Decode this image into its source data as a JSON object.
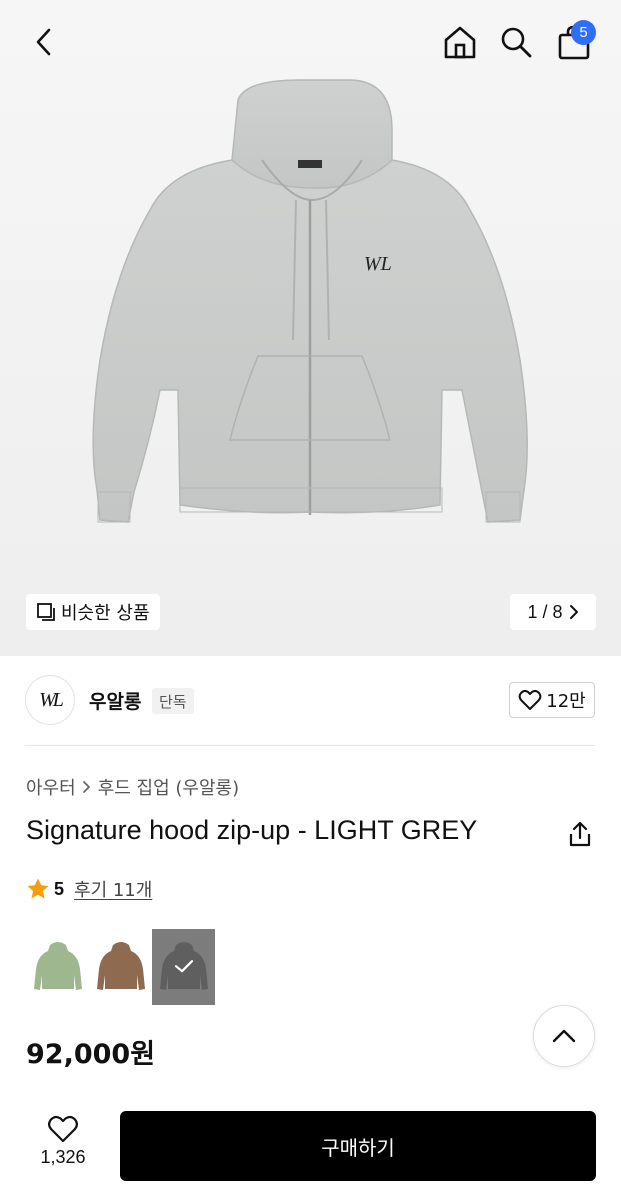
{
  "header": {
    "back_icon": "chevron-left-icon",
    "home_icon": "home-icon",
    "search_icon": "search-icon",
    "cart_icon": "shopping-bag-icon",
    "cart_count": "5"
  },
  "gallery": {
    "similar_label": "비슷한 상품",
    "counter": "1 / 8",
    "colors": {
      "hoodie": "#c9cbca",
      "badge": "#2f6ff5"
    }
  },
  "brand": {
    "logo_text": "WL",
    "name": "우알롱",
    "tag": "단독",
    "likes": "12만"
  },
  "product": {
    "breadcrumb": [
      "아우터",
      "후드 집업 (우알롱)"
    ],
    "title": "Signature hood zip-up - LIGHT GREY",
    "rating": "5",
    "reviews": "후기 11개",
    "thumbnails": [
      {
        "name": "green",
        "color": "#9fb78f",
        "selected": false
      },
      {
        "name": "brown",
        "color": "#8e6a50",
        "selected": false
      },
      {
        "name": "grey",
        "color": "#6b6b6b",
        "selected": true
      }
    ],
    "price": "92,000원"
  },
  "bottom_bar": {
    "wish_count": "1,326",
    "buy_label": "구매하기"
  }
}
